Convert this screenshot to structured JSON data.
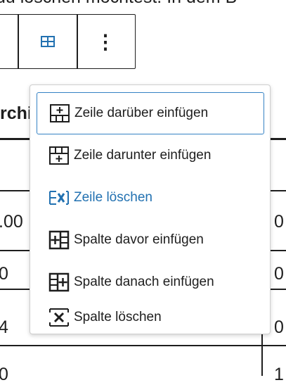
{
  "top_text": "du löschen möchtest. In dem B",
  "toolbar": {
    "table_icon": "table-grid-icon",
    "more_label": "⋮",
    "accent": "#2271b1"
  },
  "table": {
    "header_cell": "rchi",
    "left_cells": [
      ".00",
      "0",
      "4",
      "0"
    ],
    "right_cells": [
      "0",
      "0",
      "0",
      "1"
    ]
  },
  "menu": {
    "items": [
      {
        "label": "Zeile darüber einfügen",
        "icon": "insert-row-before-icon"
      },
      {
        "label": "Zeile darunter einfügen",
        "icon": "insert-row-after-icon"
      },
      {
        "label": "Zeile löschen",
        "icon": "delete-row-icon"
      },
      {
        "label": "Spalte davor einfügen",
        "icon": "insert-column-before-icon"
      },
      {
        "label": "Spalte danach einfügen",
        "icon": "insert-column-after-icon"
      },
      {
        "label": "Spalte löschen",
        "icon": "delete-column-icon"
      }
    ],
    "focus_color": "#3582c4",
    "danger_color": "#2271b1"
  }
}
